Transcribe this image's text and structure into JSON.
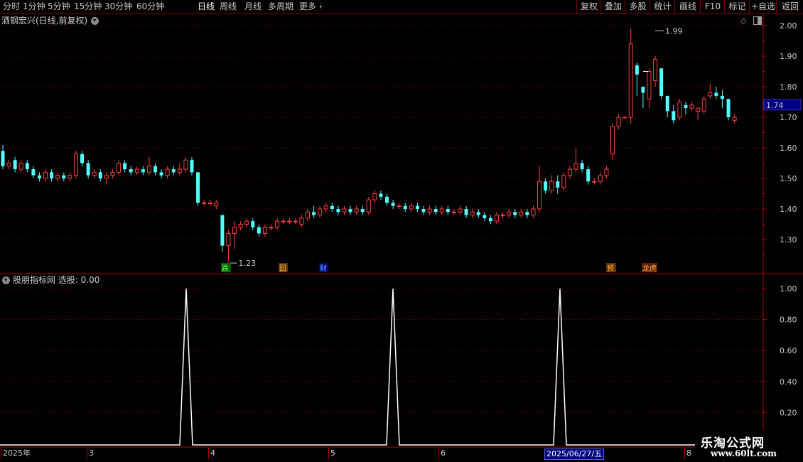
{
  "toolbar": {
    "periods": [
      "分时",
      "1分钟",
      "5分钟",
      "15分钟",
      "30分钟",
      "60分钟",
      "日线",
      "周线",
      "月线",
      "多周期",
      "更多"
    ],
    "active_period": "日线",
    "right_buttons": [
      "复权",
      "叠加",
      "多股",
      "统计",
      "画线",
      "F10",
      "标记",
      "+自选",
      "返回"
    ]
  },
  "main_panel": {
    "title": "酒钢宏兴(日线,前复权)",
    "price_labels": [
      "2.00",
      "1.90",
      "1.80",
      "1.70",
      "1.60",
      "1.50",
      "1.40",
      "1.30"
    ],
    "current_price": "1.74",
    "high_label": "1.99",
    "low_label": "1.23",
    "badges": [
      "跌",
      "回",
      "财",
      "预",
      "龙虎"
    ]
  },
  "indicator_panel": {
    "title": "股朋指标网 选股: 0.00",
    "labels": [
      "1.00",
      "0.80",
      "0.60",
      "0.40",
      "0.20"
    ]
  },
  "time_axis": {
    "labels": [
      "2025年",
      "3",
      "4",
      "5",
      "6",
      "8"
    ],
    "cursor_date": "2025/06/27/五"
  },
  "watermark": {
    "text": "乐淘公式网",
    "url": "www.60lt.com"
  },
  "colors": {
    "up": "#ff4040",
    "down": "#54fcfc",
    "grid": "#7a0000",
    "axis": "#b00000"
  }
}
